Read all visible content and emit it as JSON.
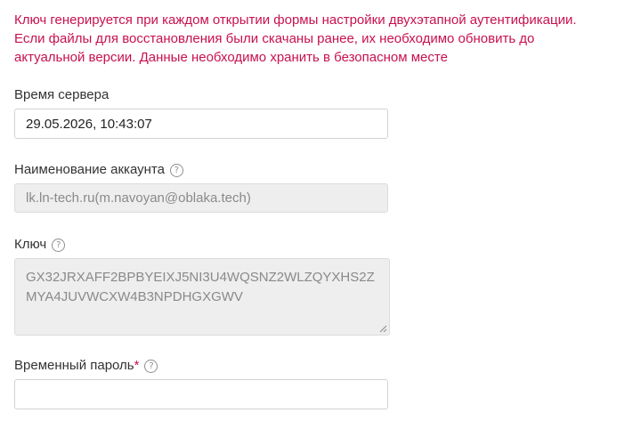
{
  "notice": {
    "text": "Ключ генерируется при каждом открытии формы настройки двухэтапной аутентификации. Если файлы для восстановления были скачаны ранее, их необходимо обновить до актуальной версии. Данные необходимо хранить в безопасном месте",
    "color": "#c8114f"
  },
  "server_time": {
    "label": "Время сервера",
    "value": "29.05.2026, 10:43:07"
  },
  "account_name": {
    "label": "Наименование аккаунта",
    "value": "lk.ln-tech.ru(m.navoyan@oblaka.tech)",
    "help_icon": "question-circle-icon"
  },
  "key": {
    "label": "Ключ",
    "value": "GX32JRXAFF2BPBYEIXJ5NI3U4WQSNZ2WLZQYXHS2ZMYA4JUVWCXW4B3NPDHGXGWV",
    "help_icon": "question-circle-icon"
  },
  "temp_password": {
    "label": "Временный пароль",
    "required_mark": "*",
    "value": "",
    "help_icon": "question-circle-icon"
  },
  "help_glyph": "?"
}
